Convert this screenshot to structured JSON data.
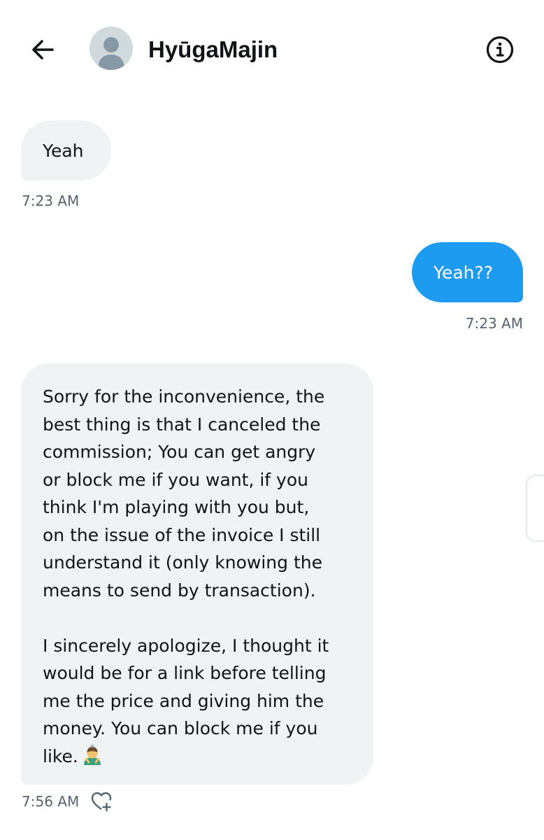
{
  "header": {
    "contact_name": "HyūgaMajin",
    "back_icon": "arrow-left-icon",
    "info_icon": "info-icon",
    "avatar_icon": "default-avatar-icon"
  },
  "messages": [
    {
      "direction": "incoming",
      "text": "Yeah",
      "time": "7:23 AM"
    },
    {
      "direction": "outgoing",
      "text": "Yeah??",
      "time": "7:23 AM"
    },
    {
      "direction": "incoming",
      "paragraph1": [
        "Sorry for the inconvenience, the",
        "best thing is that I canceled the",
        "commission; You can get angry",
        "or block me if you want, if you",
        "think I'm playing with you but,",
        "on the issue of the invoice I still",
        "understand it (only knowing the",
        "means to send by transaction)."
      ],
      "paragraph2": [
        "I sincerely apologize, I thought it",
        "would be for a link before telling",
        "me the price and giving him the",
        "money. You can block me if you",
        "like."
      ],
      "emoji": "person-bowing-emoji",
      "time": "7:56 AM",
      "react_icon": "heart-plus-icon"
    }
  ],
  "colors": {
    "incoming_bubble": "#eff3f4",
    "outgoing_bubble": "#1d9bf0",
    "timestamp": "#536471",
    "text": "#0f1419"
  }
}
